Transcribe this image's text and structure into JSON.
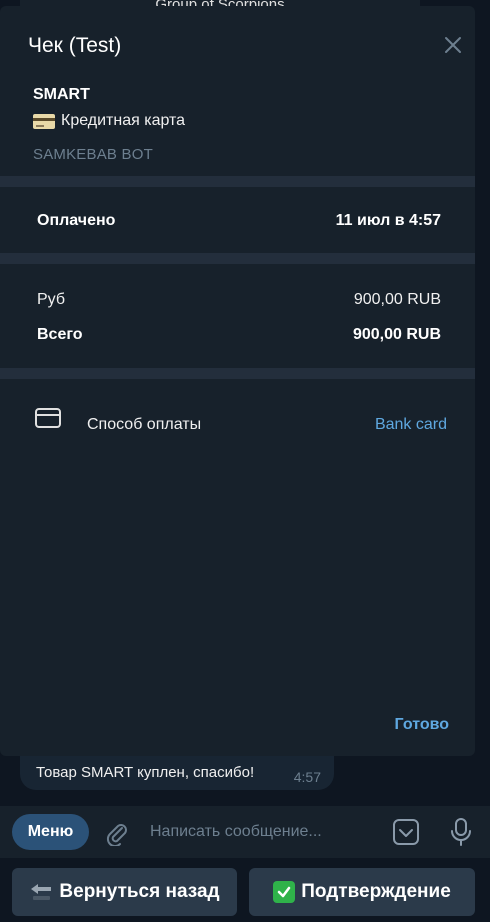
{
  "chat_header": {
    "title_fragment": "Group of Scorpions"
  },
  "modal": {
    "title": "Чек (Test)",
    "product": {
      "name": "SMART",
      "description": "Кредитная карта",
      "bot": "SAMKEBAB BOT"
    },
    "paid": {
      "label": "Оплачено",
      "value": "11 июл в 4:57"
    },
    "prices": [
      {
        "label": "Руб",
        "value": "900,00 RUB"
      },
      {
        "label": "Всего",
        "value": "900,00 RUB"
      }
    ],
    "payment_method": {
      "label": "Способ оплаты",
      "value": "Bank card"
    },
    "done_label": "Готово"
  },
  "message": {
    "text": "Товар SMART куплен, спасибо!",
    "time": "4:57"
  },
  "input_bar": {
    "menu_label": "Меню",
    "placeholder": "Написать сообщение..."
  },
  "reply_keyboard": {
    "back_label": "Вернуться назад",
    "confirm_label": "Подтверждение"
  },
  "colors": {
    "background": "#0e1621",
    "panel": "#17212b",
    "accent": "#5fa8e0",
    "menu_button": "#2b5278",
    "keyboard_button": "#2b3a4a"
  }
}
